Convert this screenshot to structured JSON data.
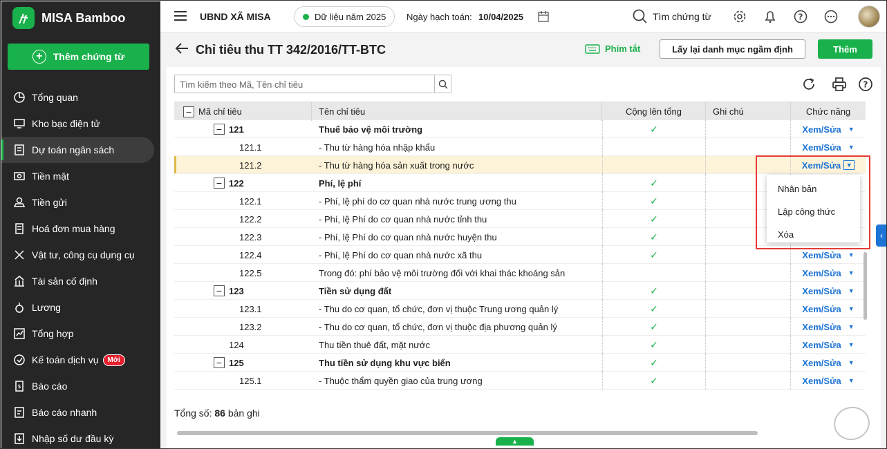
{
  "app": {
    "brand": "MISA Bamboo",
    "add_voucher": "Thêm chứng từ"
  },
  "sidebar": {
    "items": [
      {
        "label": "Tổng quan",
        "icon": "pie-chart-icon"
      },
      {
        "label": "Kho bạc điện tử",
        "icon": "monitor-icon"
      },
      {
        "label": "Dự toán ngân sách",
        "icon": "budget-icon",
        "active": true
      },
      {
        "label": "Tiền mặt",
        "icon": "cash-icon"
      },
      {
        "label": "Tiền gửi",
        "icon": "deposit-icon"
      },
      {
        "label": "Hoá đơn mua hàng",
        "icon": "invoice-icon"
      },
      {
        "label": "Vật tư, công cụ dụng cụ",
        "icon": "tools-icon"
      },
      {
        "label": "Tài sản cố định",
        "icon": "building-icon"
      },
      {
        "label": "Lương",
        "icon": "salary-icon"
      },
      {
        "label": "Tổng hợp",
        "icon": "summary-icon"
      },
      {
        "label": "Kế toán dịch vụ",
        "icon": "service-icon",
        "badge": "Mới"
      },
      {
        "label": "Báo cáo",
        "icon": "report-icon"
      },
      {
        "label": "Báo cáo nhanh",
        "icon": "quick-report-icon"
      },
      {
        "label": "Nhập số dư đầu kỳ",
        "icon": "import-icon"
      }
    ]
  },
  "topbar": {
    "org": "UBND XÃ MISA",
    "data_year": "Dữ liệu năm 2025",
    "acct_label": "Ngày hạch toán:",
    "acct_date": "10/04/2025",
    "search": "Tìm chứng từ"
  },
  "page": {
    "title": "Chỉ tiêu thu TT 342/2016/TT-BTC",
    "shortcut": "Phím tắt",
    "reset": "Lấy lại danh mục ngầm định",
    "add": "Thêm",
    "search_placeholder": "Tìm kiếm theo Mã, Tên chỉ tiêu",
    "total_label": "Tổng số:",
    "total_count": "86",
    "total_unit": "bản ghi"
  },
  "table": {
    "headers": [
      "Mã chỉ tiêu",
      "Tên chỉ tiêu",
      "Cộng lên tổng",
      "Ghi chú",
      "Chức năng"
    ],
    "action_label": "Xem/Sửa",
    "rows": [
      {
        "code": "121",
        "name": "Thuế bảo vệ môi trường",
        "level": 0,
        "group": true,
        "sum": true
      },
      {
        "code": "121.1",
        "name": "- Thu từ hàng hóa nhập khẩu",
        "level": 1,
        "sum": false
      },
      {
        "code": "121.2",
        "name": "- Thu từ hàng hóa sản xuất trong nước",
        "level": 1,
        "sum": false,
        "selected": true
      },
      {
        "code": "122",
        "name": "Phí, lệ phí",
        "level": 0,
        "group": true,
        "sum": true
      },
      {
        "code": "122.1",
        "name": "- Phí, lệ phí do cơ quan nhà nước trung ương thu",
        "level": 1,
        "sum": true
      },
      {
        "code": "122.2",
        "name": "- Phí, lệ Phí do cơ quan nhà nước tỉnh thu",
        "level": 1,
        "sum": true
      },
      {
        "code": "122.3",
        "name": "- Phí, lệ Phí do cơ quan nhà nước huyện thu",
        "level": 1,
        "sum": true
      },
      {
        "code": "122.4",
        "name": "- Phí, lệ Phí do cơ quan nhà nước xã thu",
        "level": 1,
        "sum": true
      },
      {
        "code": "122.5",
        "name": "Trong đó: phí bảo vệ môi trường đối với khai thác khoáng sản",
        "level": 1,
        "sum": false
      },
      {
        "code": "123",
        "name": "Tiền sử dụng đất",
        "level": 0,
        "group": true,
        "sum": true
      },
      {
        "code": "123.1",
        "name": "- Thu do cơ quan, tổ chức, đơn vị thuộc Trung ương quản lý",
        "level": 1,
        "sum": true
      },
      {
        "code": "123.2",
        "name": "- Thu do cơ quan, tổ chức, đơn vị thuộc địa phương quản lý",
        "level": 1,
        "sum": true
      },
      {
        "code": "124",
        "name": "Thu tiền thuê đất, mặt nước",
        "level": 0,
        "group": false,
        "sum": true
      },
      {
        "code": "125",
        "name": "Thu tiền sử dụng khu vực biển",
        "level": 0,
        "group": true,
        "sum": true
      },
      {
        "code": "125.1",
        "name": "- Thuộc thẩm quyền giao của trung ương",
        "level": 1,
        "sum": true
      }
    ]
  },
  "dropdown": {
    "items": [
      "Nhân bản",
      "Lập công thức",
      "Xóa"
    ]
  },
  "colors": {
    "brand": "#19b14b",
    "link": "#1e74d6",
    "sidebar": "#262626",
    "highlight": "#e53935"
  }
}
